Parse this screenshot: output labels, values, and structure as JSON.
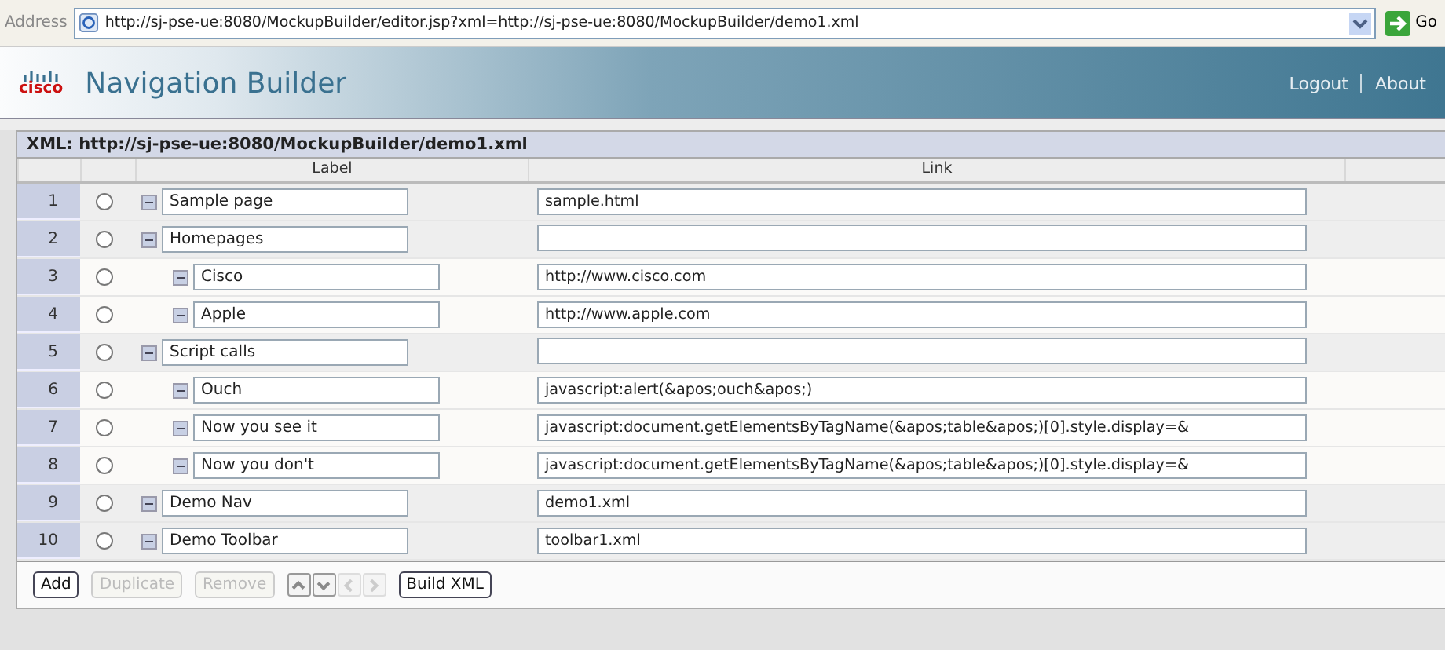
{
  "address_bar": {
    "label": "Address",
    "url": "http://sj-pse-ue:8080/MockupBuilder/editor.jsp?xml=http://sj-pse-ue:8080/MockupBuilder/demo1.xml",
    "go": "Go"
  },
  "header": {
    "logo": "cisco",
    "title": "Navigation Builder",
    "links": [
      "Logout",
      "About"
    ]
  },
  "panel": {
    "title": "XML: http://sj-pse-ue:8080/MockupBuilder/demo1.xml",
    "columns": [
      "Label",
      "Link"
    ],
    "rows": [
      {
        "number": "1",
        "selected": false,
        "label": "Sample page",
        "link": "sample.html"
      },
      {
        "number": "2",
        "selected": false,
        "label": "Homepages",
        "children": [
          {
            "number": "3",
            "selected": false,
            "label": "Cisco",
            "link": "http://www.cisco.com"
          },
          {
            "number": "4",
            "selected": false,
            "label": "Apple",
            "link": "http://www.apple.com"
          }
        ]
      },
      {
        "number": "5",
        "selected": false,
        "label": "Script calls",
        "children": [
          {
            "number": "6",
            "selected": false,
            "label": "Ouch",
            "link": "javascript:alert(&apos;ouch&apos;)"
          },
          {
            "number": "7",
            "selected": false,
            "label": "Now you see it",
            "link": "javascript:document.getElementsByTagName(&apos;table&apos;)[0].style.display=&"
          },
          {
            "number": "8",
            "selected": false,
            "label": "Now you don't",
            "link": "javascript:document.getElementsByTagName(&apos;table&apos;)[0].style.display=&"
          }
        ]
      },
      {
        "number": "9",
        "selected": false,
        "label": "Demo Nav",
        "link": "demo1.xml"
      },
      {
        "number": "10",
        "selected": false,
        "label": "Demo Toolbar",
        "link": "toolbar1.xml"
      }
    ],
    "buttons": [
      {
        "kind": "text",
        "label": "Add",
        "disabled": false
      },
      {
        "kind": "text",
        "label": "Duplicate",
        "disabled": true
      },
      {
        "kind": "text",
        "label": "Remove",
        "disabled": true
      },
      {
        "kind": "up",
        "disabled": false
      },
      {
        "kind": "down",
        "disabled": false
      },
      {
        "kind": "left",
        "disabled": true
      },
      {
        "kind": "right",
        "disabled": true
      },
      {
        "kind": "text",
        "label": "Build XML",
        "disabled": false
      }
    ]
  }
}
